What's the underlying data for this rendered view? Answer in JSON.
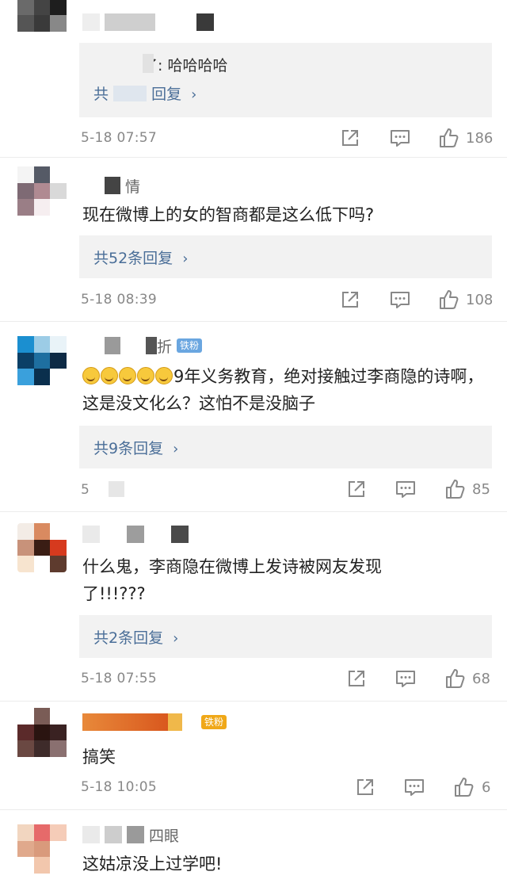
{
  "icons": {
    "share": "share-icon",
    "comment": "comment-icon",
    "like": "like-icon",
    "chevron": "chevron-right-icon",
    "emoji": "grinning-sweat-emoji"
  },
  "colors": {
    "link": "#4a6e98",
    "reply_bg": "#f2f2f2",
    "badge_fan": "#6aa6e0",
    "badge_gold": "#f0a818"
  },
  "comments": [
    {
      "reply_quote": "了: 哈哈哈哈",
      "reply_link": "共",
      "reply_link_tail": "回复",
      "time": "5-18 07:57",
      "likes": "186"
    },
    {
      "name": "情",
      "text": "现在微博上的女的智商都是这么低下吗?",
      "reply_link": "共52条回复",
      "time": "5-18 08:39",
      "likes": "108"
    },
    {
      "name": "折",
      "badge": "铁粉",
      "text_tail": "9年义务教育，绝对接触过李商隐的诗啊，这是没文化么？这怕不是没脑子",
      "reply_link": "共9条回复",
      "time": "5",
      "likes": "85"
    },
    {
      "text": "什么鬼，李商隐在微博上发诗被网友发现了!!!???",
      "reply_link": "共2条回复",
      "time": "5-18 07:55",
      "likes": "68"
    },
    {
      "badge": "铁粉",
      "text": "搞笑",
      "time": "5-18 10:05",
      "likes": "6"
    },
    {
      "name": "四眼",
      "text": "这姑凉没上过学吧!"
    }
  ]
}
